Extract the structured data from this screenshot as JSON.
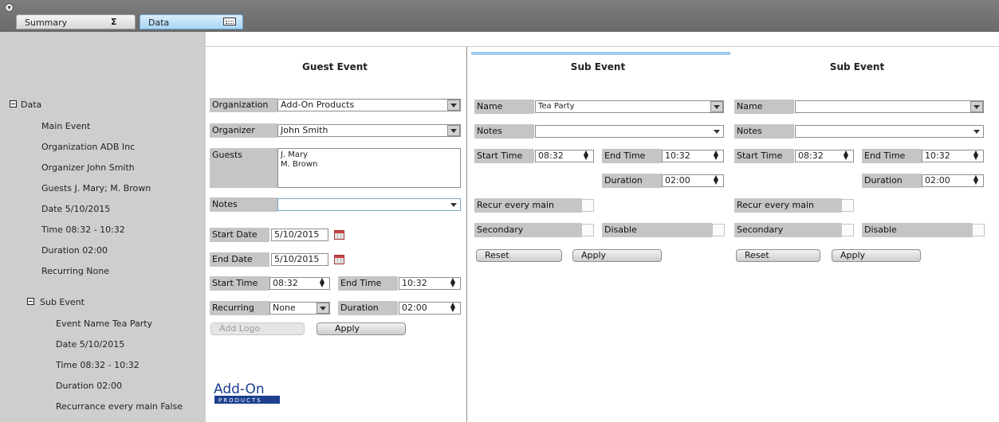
{
  "tabs": {
    "summary_label": "Summary",
    "summary_icon": "sigma-icon",
    "summary_glyph": "Σ",
    "data_label": "Data",
    "data_icon": "keyboard-icon"
  },
  "tree": {
    "root_label": "Data",
    "items": [
      "Main Event",
      "Organization ADB Inc",
      "Organizer John Smith",
      "Guests J. Mary; M. Brown",
      "Date 5/10/2015",
      "Time 08:32 - 10:32",
      "Duration 02:00",
      "Recurring None"
    ],
    "sub_label": "Sub Event",
    "sub_items": [
      "Event Name Tea Party",
      "Date 5/10/2015",
      "Time 08:32 - 10:32",
      "Duration 02:00",
      "Recurrance every main False"
    ]
  },
  "guest": {
    "title": "Guest Event",
    "organization_label": "Organization",
    "organization_value": "Add-On Products",
    "organizer_label": "Organizer",
    "organizer_value": "John Smith",
    "guests_label": "Guests",
    "guests_values": [
      "J. Mary",
      "M. Brown"
    ],
    "notes_label": "Notes",
    "notes_value": "",
    "start_date_label": "Start Date",
    "start_date_value": "5/10/2015",
    "end_date_label": "End Date",
    "end_date_value": "5/10/2015",
    "start_time_label": "Start Time",
    "start_time_value": "08:32",
    "end_time_label": "End Time",
    "end_time_value": "10:32",
    "recurring_label": "Recurring",
    "recurring_value": "None",
    "duration_label": "Duration",
    "duration_value": "02:00",
    "add_logo_label": "Add Logo",
    "apply_label": "Apply",
    "logo_text_top": "Add-On",
    "logo_text_bottom": "PRODUCTS"
  },
  "sub1": {
    "title": "Sub Event",
    "name_label": "Name",
    "name_value": "Tea Party",
    "notes_label": "Notes",
    "notes_value": "",
    "start_time_label": "Start Time",
    "start_time_value": "08:32",
    "end_time_label": "End Time",
    "end_time_value": "10:32",
    "duration_label": "Duration",
    "duration_value": "02:00",
    "recur_label": "Recur every main",
    "secondary_label": "Secondary",
    "disable_label": "Disable",
    "reset_label": "Reset",
    "apply_label": "Apply"
  },
  "sub2": {
    "title": "Sub Event",
    "name_label": "Name",
    "name_value": "",
    "notes_label": "Notes",
    "notes_value": "",
    "start_time_label": "Start Time",
    "start_time_value": "08:32",
    "end_time_label": "End Time",
    "end_time_value": "10:32",
    "duration_label": "Duration",
    "duration_value": "02:00",
    "recur_label": "Recur every main",
    "secondary_label": "Secondary",
    "disable_label": "Disable",
    "reset_label": "Reset",
    "apply_label": "Apply"
  },
  "colors": {
    "accent": "#9fcdf0",
    "logo_blue": "#1c3f8f"
  }
}
